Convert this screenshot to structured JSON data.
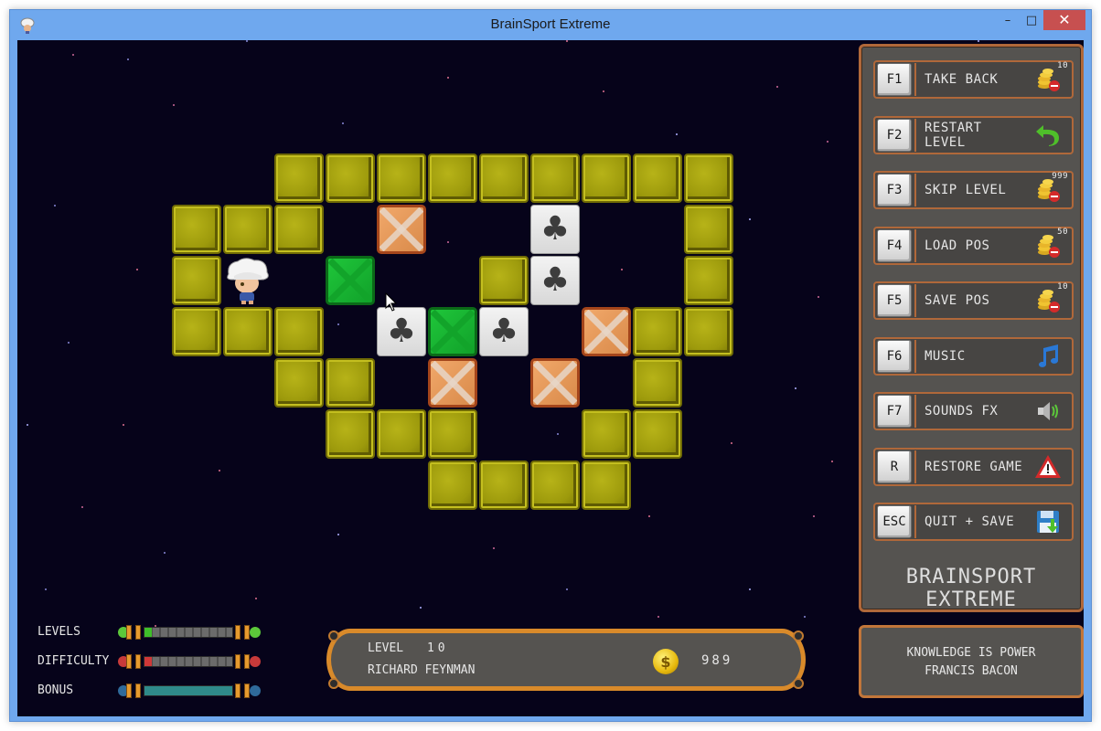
{
  "window": {
    "title": "BrainSport Extreme",
    "controls": {
      "minimize": "–",
      "maximize": "□",
      "close": "✕"
    }
  },
  "board": {
    "player_name_icon": "player-sprite",
    "legend": {
      "wall": "wall-block",
      "crate": "crate-unplaced",
      "placed": "crate-on-target",
      "target": "clover-target",
      "player": "player"
    },
    "tiles": [
      {
        "type": "wall",
        "col": 2,
        "row": 0
      },
      {
        "type": "wall",
        "col": 3,
        "row": 0
      },
      {
        "type": "wall",
        "col": 4,
        "row": 0
      },
      {
        "type": "wall",
        "col": 5,
        "row": 0
      },
      {
        "type": "wall",
        "col": 6,
        "row": 0
      },
      {
        "type": "wall",
        "col": 7,
        "row": 0
      },
      {
        "type": "wall",
        "col": 8,
        "row": 0
      },
      {
        "type": "wall",
        "col": 9,
        "row": 0
      },
      {
        "type": "wall",
        "col": 10,
        "row": 0
      },
      {
        "type": "wall",
        "col": 0,
        "row": 1
      },
      {
        "type": "wall",
        "col": 1,
        "row": 1
      },
      {
        "type": "wall",
        "col": 2,
        "row": 1
      },
      {
        "type": "crate",
        "col": 4,
        "row": 1
      },
      {
        "type": "target",
        "col": 7,
        "row": 1
      },
      {
        "type": "wall",
        "col": 10,
        "row": 1
      },
      {
        "type": "wall",
        "col": 0,
        "row": 2
      },
      {
        "type": "player",
        "col": 1,
        "row": 2
      },
      {
        "type": "placed",
        "col": 3,
        "row": 2
      },
      {
        "type": "wall",
        "col": 6,
        "row": 2
      },
      {
        "type": "target",
        "col": 7,
        "row": 2
      },
      {
        "type": "wall",
        "col": 10,
        "row": 2
      },
      {
        "type": "wall",
        "col": 0,
        "row": 3
      },
      {
        "type": "wall",
        "col": 1,
        "row": 3
      },
      {
        "type": "wall",
        "col": 2,
        "row": 3
      },
      {
        "type": "target",
        "col": 4,
        "row": 3
      },
      {
        "type": "placed",
        "col": 5,
        "row": 3
      },
      {
        "type": "target",
        "col": 6,
        "row": 3
      },
      {
        "type": "crate",
        "col": 8,
        "row": 3
      },
      {
        "type": "wall",
        "col": 9,
        "row": 3
      },
      {
        "type": "wall",
        "col": 10,
        "row": 3
      },
      {
        "type": "wall",
        "col": 2,
        "row": 4
      },
      {
        "type": "wall",
        "col": 3,
        "row": 4
      },
      {
        "type": "crate",
        "col": 5,
        "row": 4
      },
      {
        "type": "crate",
        "col": 7,
        "row": 4
      },
      {
        "type": "wall",
        "col": 9,
        "row": 4
      },
      {
        "type": "wall",
        "col": 3,
        "row": 5
      },
      {
        "type": "wall",
        "col": 4,
        "row": 5
      },
      {
        "type": "wall",
        "col": 5,
        "row": 5
      },
      {
        "type": "wall",
        "col": 8,
        "row": 5
      },
      {
        "type": "wall",
        "col": 9,
        "row": 5
      },
      {
        "type": "wall",
        "col": 5,
        "row": 6
      },
      {
        "type": "wall",
        "col": 6,
        "row": 6
      },
      {
        "type": "wall",
        "col": 7,
        "row": 6
      },
      {
        "type": "wall",
        "col": 8,
        "row": 6
      }
    ]
  },
  "side_panel": {
    "actions": [
      {
        "key": "F1",
        "label": "TAKE BACK",
        "icon": "coins-minus-icon",
        "cost": "10"
      },
      {
        "key": "F2",
        "label": "RESTART LEVEL",
        "icon": "undo-arrow-icon",
        "cost": ""
      },
      {
        "key": "F3",
        "label": "SKIP LEVEL",
        "icon": "coins-minus-icon",
        "cost": "999"
      },
      {
        "key": "F4",
        "label": "LOAD POS",
        "icon": "coins-minus-icon",
        "cost": "50"
      },
      {
        "key": "F5",
        "label": "SAVE POS",
        "icon": "coins-minus-icon",
        "cost": "10"
      },
      {
        "key": "F6",
        "label": "MUSIC",
        "icon": "music-note-icon",
        "cost": ""
      },
      {
        "key": "F7",
        "label": "SOUNDS FX",
        "icon": "speaker-icon",
        "cost": ""
      },
      {
        "key": "R",
        "label": "RESTORE GAME",
        "icon": "warning-icon",
        "cost": ""
      },
      {
        "key": "ESC",
        "label": "QUIT + SAVE",
        "icon": "floppy-save-icon",
        "cost": ""
      }
    ],
    "brand": "BRAINSPORT EXTREME"
  },
  "quote": {
    "line1": "KNOWLEDGE IS POWER",
    "line2": "FRANCIS BACON"
  },
  "level_info": {
    "level_label": "LEVEL",
    "level_number": "10",
    "player_name": "RICHARD FEYNMAN",
    "coin_symbol": "$",
    "coins": "989"
  },
  "meters": [
    {
      "label": "LEVELS",
      "fill_percent": 8,
      "color": "#3fbf2a"
    },
    {
      "label": "DIFFICULTY",
      "fill_percent": 8,
      "color": "#cf3838"
    },
    {
      "label": "BONUS",
      "fill_percent": 100,
      "color": "#2f8a8a"
    }
  ],
  "colors": {
    "background": "#06031a",
    "panel": "#555350",
    "panel_border": "#b0683a",
    "titlebar": "#6fa8ee",
    "close": "#c75050"
  }
}
